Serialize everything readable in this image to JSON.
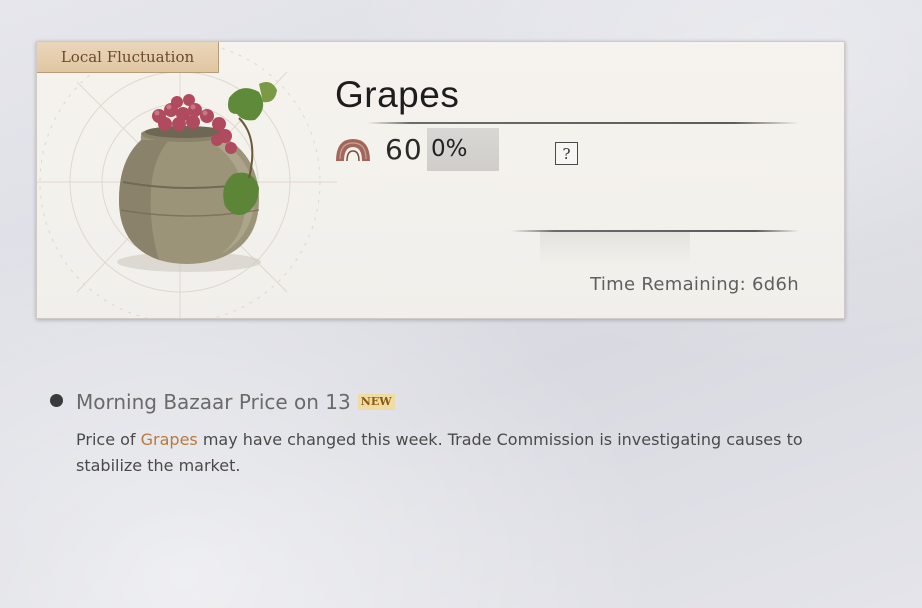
{
  "card": {
    "tag_label": "Local Fluctuation",
    "item_name": "Grapes",
    "currency_icon": "coin-icon",
    "price": "60",
    "change_percent": "0%",
    "help_label": "?",
    "time_remaining": "Time Remaining: 6d6h"
  },
  "news": {
    "title": "Morning Bazaar Price on 13",
    "badge": "NEW",
    "body_prefix": "Price of ",
    "body_highlight": "Grapes",
    "body_suffix": " may have changed this week. Trade Commission is investigating causes to stabilize the market."
  },
  "colors": {
    "tag_bg": "#e1c6a2",
    "highlight": "#b77a3f",
    "badge_bg": "#f0dba5"
  }
}
